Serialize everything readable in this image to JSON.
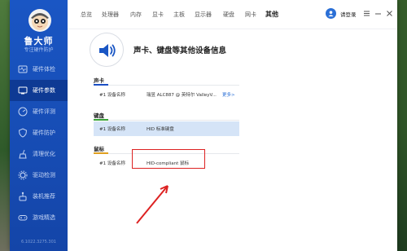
{
  "app": {
    "name": "鲁大师",
    "tagline": "专注硬件防护",
    "version": "6.1022.3275.301"
  },
  "sidebar": {
    "items": [
      {
        "label": "硬件体检",
        "icon": "heartbeat-icon"
      },
      {
        "label": "硬件参数",
        "icon": "monitor-icon"
      },
      {
        "label": "硬件评测",
        "icon": "speedometer-icon"
      },
      {
        "label": "硬件防护",
        "icon": "shield-icon"
      },
      {
        "label": "清理优化",
        "icon": "broom-icon"
      },
      {
        "label": "驱动检测",
        "icon": "gear-icon"
      },
      {
        "label": "装机推荐",
        "icon": "joystick-icon"
      },
      {
        "label": "游戏精选",
        "icon": "gamepad-icon"
      }
    ]
  },
  "tabs": [
    "总览",
    "处理器",
    "内存",
    "显卡",
    "主板",
    "显示器",
    "硬盘",
    "网卡",
    "其他"
  ],
  "active_tab": "其他",
  "user": {
    "label": "请登录"
  },
  "page": {
    "title": "声卡、键盘等其他设备信息"
  },
  "sections": {
    "sound": {
      "label": "声卡",
      "accent": "#1a4fc4",
      "row": {
        "label": "#1 设备名称",
        "value": "瑞昱 ALC887 @ 英特尔 ValleyV...",
        "more": "更多>"
      }
    },
    "keyboard": {
      "label": "键盘",
      "accent": "#3aa33a",
      "row": {
        "label": "#1 设备名称",
        "value": "HID 标准键盘"
      }
    },
    "mouse": {
      "label": "鼠标",
      "accent": "#e0a020",
      "row": {
        "label": "#1 设备名称",
        "value": "HID-compliant 鼠标"
      }
    }
  },
  "colors": {
    "sidebar": "#1a56c4",
    "sidebar_active": "#0e3a94",
    "highlight_row": "#d5e4f7",
    "annotation": "#dd2222"
  }
}
